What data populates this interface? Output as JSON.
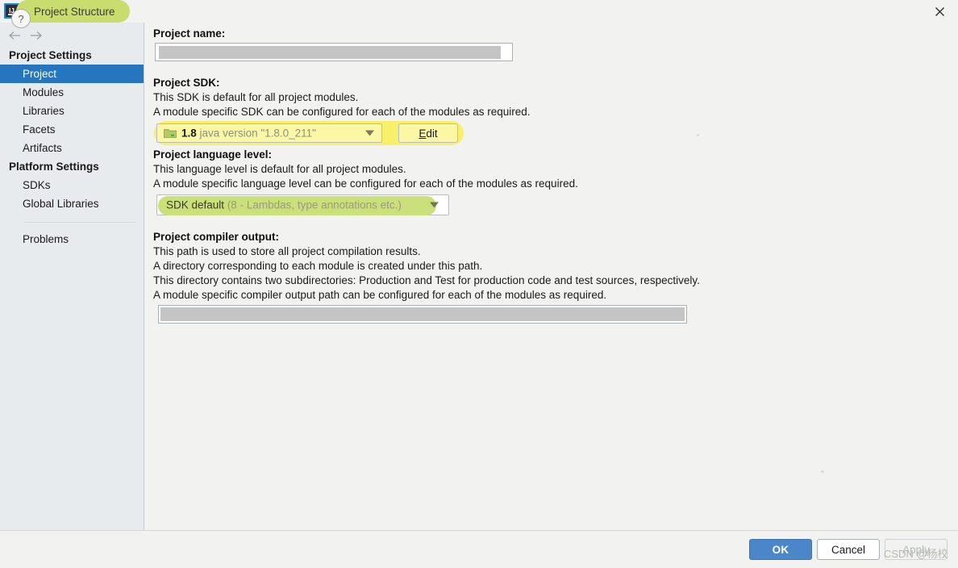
{
  "window": {
    "title": "Project Structure",
    "app_icon": "intellij-idea-icon",
    "close_icon": "close-icon"
  },
  "nav": {
    "back_icon": "arrow-left-icon",
    "forward_icon": "arrow-right-icon"
  },
  "sidebar": {
    "groups": [
      {
        "label": "Project Settings",
        "items": [
          {
            "label": "Project",
            "selected": true
          },
          {
            "label": "Modules",
            "selected": false
          },
          {
            "label": "Libraries",
            "selected": false
          },
          {
            "label": "Facets",
            "selected": false
          },
          {
            "label": "Artifacts",
            "selected": false
          }
        ]
      },
      {
        "label": "Platform Settings",
        "items": [
          {
            "label": "SDKs",
            "selected": false
          },
          {
            "label": "Global Libraries",
            "selected": false
          }
        ]
      }
    ],
    "problems_label": "Problems"
  },
  "main": {
    "project_name": {
      "label": "Project name:",
      "value": "",
      "redacted": true
    },
    "project_sdk": {
      "label": "Project SDK:",
      "descriptions": [
        "This SDK is default for all project modules.",
        "A module specific SDK can be configured for each of the modules as required."
      ],
      "combo_icon": "folder-icon",
      "combo_value_name": "1.8",
      "combo_value_detail": "java version \"1.8.0_211\"",
      "dropdown_icon": "chevron-down-icon",
      "edit_button": "Edit",
      "edit_button_mnemonic": "E",
      "edit_button_rest": "dit",
      "highlight_color": "#f7f06a"
    },
    "language_level": {
      "label": "Project language level:",
      "descriptions": [
        "This language level is default for all project modules.",
        "A module specific language level can be configured for each of the modules as required."
      ],
      "combo_value_name": "SDK default",
      "combo_value_detail": "(8 - Lambdas, type annotations etc.)",
      "dropdown_icon": "chevron-down-icon",
      "highlight_color": "#cbe07a"
    },
    "compiler_output": {
      "label": "Project compiler output:",
      "descriptions": [
        "This path is used to store all project compilation results.",
        "A directory corresponding to each module is created under this path.",
        "This directory contains two subdirectories: Production and Test for production code and test sources, respectively.",
        "A module specific compiler output path can be configured for each of the modules as required."
      ],
      "value": "",
      "redacted": true
    }
  },
  "footer": {
    "help_icon": "question-mark-icon",
    "help_label": "?",
    "ok_label": "OK",
    "cancel_label": "Cancel",
    "apply_label": "Apply",
    "apply_enabled": false,
    "watermark": "CSDN @杨校"
  },
  "colors": {
    "selection_blue": "#2675bf",
    "primary_button": "#4a86c8",
    "sdk_highlight": "#f7f06a",
    "lang_highlight": "#cbe07a",
    "title_highlight": "#c9dd6e",
    "sidebar_bg": "#e8ebed",
    "panel_bg": "#f2f2f0"
  }
}
